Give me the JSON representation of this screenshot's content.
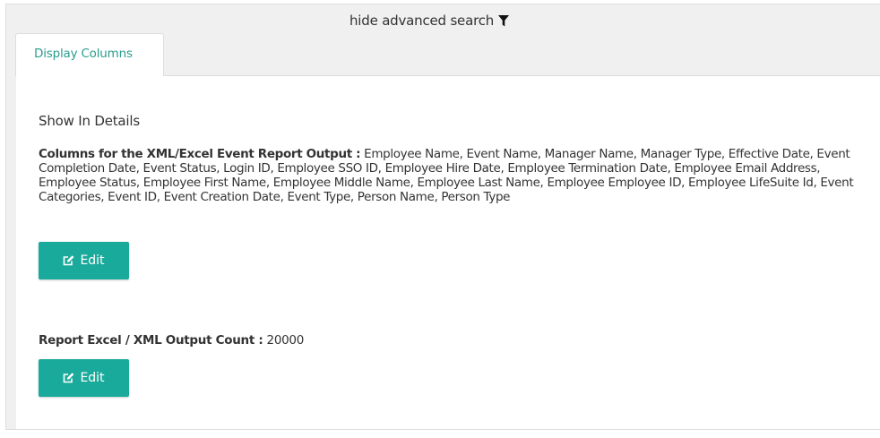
{
  "advanced_search": {
    "toggle_label": "hide advanced search",
    "icon": "filter-icon"
  },
  "tabs": [
    {
      "label": "Display Columns",
      "active": true
    }
  ],
  "details": {
    "section_title": "Show In Details",
    "columns_label": "Columns for the XML/Excel Event Report Output :",
    "columns_value": "Employee Name, Event Name, Manager Name, Manager Type, Effective Date, Event Completion Date, Event Status, Login ID, Employee SSO ID, Employee Hire Date, Employee Termination Date, Employee Email Address, Employee Status, Employee First Name, Employee Middle Name, Employee Last Name, Employee Employee ID, Employee LifeSuite Id, Event Categories, Event ID, Event Creation Date, Event Type, Person Name, Person Type",
    "columns_edit_label": "Edit",
    "count_label": "Report Excel / XML Output Count :",
    "count_value": "20000",
    "count_edit_label": "Edit",
    "edit_icon": "edit-icon"
  },
  "colors": {
    "accent": "#1aaa9b",
    "tab_text": "#2a9d8f",
    "header_bg": "#f0f0f0",
    "border": "#dddddd"
  }
}
